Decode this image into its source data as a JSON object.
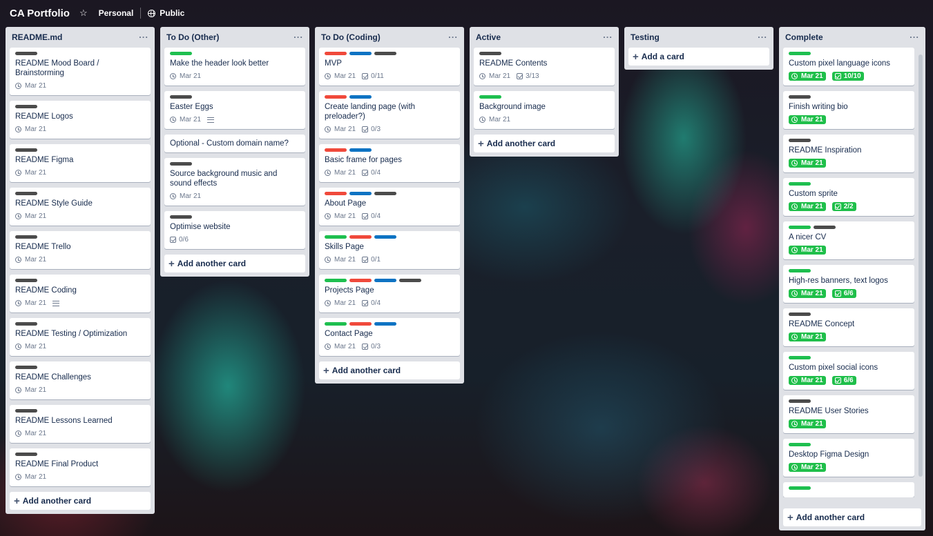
{
  "header": {
    "title": "CA Portfolio",
    "star_icon": "star-icon",
    "personal": "Personal",
    "public": "Public"
  },
  "lists": [
    {
      "title": "README.md",
      "add_label": "Add another card",
      "cards": [
        {
          "labels": [
            "gray"
          ],
          "title": "README Mood Board / Brainstorming",
          "due": "Mar 21"
        },
        {
          "labels": [
            "gray"
          ],
          "title": "README Logos",
          "due": "Mar 21"
        },
        {
          "labels": [
            "gray"
          ],
          "title": "README Figma",
          "due": "Mar 21"
        },
        {
          "labels": [
            "gray"
          ],
          "title": "README Style Guide",
          "due": "Mar 21"
        },
        {
          "labels": [
            "gray"
          ],
          "title": "README Trello",
          "due": "Mar 21"
        },
        {
          "labels": [
            "gray"
          ],
          "title": "README Coding",
          "due": "Mar 21",
          "desc": true
        },
        {
          "labels": [
            "gray"
          ],
          "title": "README Testing / Optimization",
          "due": "Mar 21"
        },
        {
          "labels": [
            "gray"
          ],
          "title": "README Challenges",
          "due": "Mar 21"
        },
        {
          "labels": [
            "gray"
          ],
          "title": "README Lessons Learned",
          "due": "Mar 21"
        },
        {
          "labels": [
            "gray"
          ],
          "title": "README Final Product",
          "due": "Mar 21"
        }
      ]
    },
    {
      "title": "To Do (Other)",
      "add_label": "Add another card",
      "cards": [
        {
          "labels": [
            "green"
          ],
          "title": "Make the header look better",
          "due": "Mar 21"
        },
        {
          "labels": [
            "gray"
          ],
          "title": "Easter Eggs",
          "due": "Mar 21",
          "desc": true
        },
        {
          "labels": [],
          "title": "Optional - Custom domain name?"
        },
        {
          "labels": [
            "gray"
          ],
          "title": "Source background music and sound effects",
          "due": "Mar 21"
        },
        {
          "labels": [
            "gray"
          ],
          "title": "Optimise website",
          "checklist": "0/6"
        }
      ]
    },
    {
      "title": "To Do (Coding)",
      "add_label": "Add another card",
      "cards": [
        {
          "labels": [
            "red",
            "blue",
            "gray"
          ],
          "title": "MVP",
          "due": "Mar 21",
          "checklist": "0/11"
        },
        {
          "labels": [
            "red",
            "blue"
          ],
          "title": "Create landing page (with preloader?)",
          "due": "Mar 21",
          "checklist": "0/3"
        },
        {
          "labels": [
            "red",
            "blue"
          ],
          "title": "Basic frame for pages",
          "due": "Mar 21",
          "checklist": "0/4"
        },
        {
          "labels": [
            "red",
            "blue",
            "gray"
          ],
          "title": "About Page",
          "due": "Mar 21",
          "checklist": "0/4"
        },
        {
          "labels": [
            "green",
            "red",
            "blue"
          ],
          "title": "Skills Page",
          "due": "Mar 21",
          "checklist": "0/1"
        },
        {
          "labels": [
            "green",
            "red",
            "blue",
            "gray"
          ],
          "title": "Projects Page",
          "due": "Mar 21",
          "checklist": "0/4"
        },
        {
          "labels": [
            "green",
            "red",
            "blue"
          ],
          "title": "Contact Page",
          "due": "Mar 21",
          "checklist": "0/3"
        }
      ]
    },
    {
      "title": "Active",
      "add_label": "Add another card",
      "cards": [
        {
          "labels": [
            "gray"
          ],
          "title": "README Contents",
          "due": "Mar 21",
          "checklist": "3/13"
        },
        {
          "labels": [
            "green"
          ],
          "title": "Background image",
          "due": "Mar 21"
        }
      ]
    },
    {
      "title": "Testing",
      "add_label": "Add a card",
      "cards": []
    },
    {
      "title": "Complete",
      "add_label": "Add another card",
      "cards": [
        {
          "labels": [
            "green"
          ],
          "title": "Custom pixel language icons",
          "due": "Mar 21",
          "checklist": "10/10",
          "done": true
        },
        {
          "labels": [
            "gray"
          ],
          "title": "Finish writing bio",
          "due": "Mar 21",
          "done": true
        },
        {
          "labels": [
            "gray"
          ],
          "title": "README Inspiration",
          "due": "Mar 21",
          "done": true
        },
        {
          "labels": [
            "green"
          ],
          "title": "Custom sprite",
          "due": "Mar 21",
          "checklist": "2/2",
          "done": true
        },
        {
          "labels": [
            "green",
            "gray"
          ],
          "title": "A nicer CV",
          "due": "Mar 21",
          "done": true
        },
        {
          "labels": [
            "green"
          ],
          "title": "High-res banners, text logos",
          "due": "Mar 21",
          "checklist": "6/6",
          "done": true
        },
        {
          "labels": [
            "gray"
          ],
          "title": "README Concept",
          "due": "Mar 21",
          "done": true
        },
        {
          "labels": [
            "green"
          ],
          "title": "Custom pixel social icons",
          "due": "Mar 21",
          "checklist": "6/6",
          "done": true
        },
        {
          "labels": [
            "gray"
          ],
          "title": "README User Stories",
          "due": "Mar 21",
          "done": true
        },
        {
          "labels": [
            "green"
          ],
          "title": "Desktop Figma Design",
          "due": "Mar 21",
          "done": true
        },
        {
          "labels": [
            "green"
          ],
          "title": "",
          "done": true
        }
      ]
    }
  ]
}
